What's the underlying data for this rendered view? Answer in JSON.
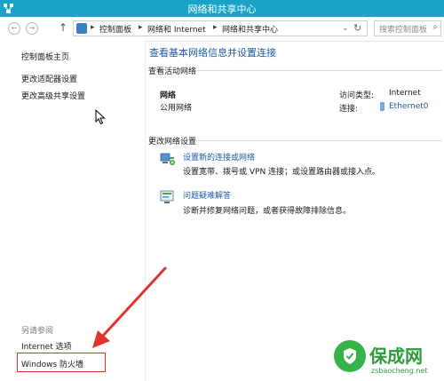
{
  "window": {
    "title": "网络和共享中心"
  },
  "address_bar": {
    "breadcrumbs": [
      "控制面板",
      "网络和 Internet",
      "网络和共享中心"
    ],
    "search_placeholder": "搜索控制面板",
    "dropdown_glyph": "⌄",
    "refresh_glyph": "↻",
    "search_glyph": "⌕",
    "up_glyph": "↑",
    "separator_glyph": "▸",
    "back_glyph": "←",
    "forward_glyph": "→"
  },
  "sidebar": {
    "links": [
      "控制面板主页",
      "更改适配器设置",
      "更改高级共享设置"
    ],
    "see_also_label": "另请参阅",
    "see_also_links": [
      "Internet 选项",
      "Windows 防火墙"
    ]
  },
  "main": {
    "title": "查看基本网络信息并设置连接",
    "active_networks_label": "查看活动网络",
    "network": {
      "name": "网络",
      "type": "公用网络",
      "access_type_label": "访问类型:",
      "access_type_value": "Internet",
      "connections_label": "连接:",
      "connection_value": "Ethernet0"
    },
    "change_settings_label": "更改网络设置",
    "tasks": [
      {
        "title": "设置新的连接或网络",
        "description": "设置宽带、拨号或 VPN 连接；或设置路由器或接入点。"
      },
      {
        "title": "问题疑难解答",
        "description": "诊断并修复网络问题，或者获得故障排除信息。"
      }
    ]
  },
  "watermark": {
    "title": "保成网",
    "url": "zsbaocheng.net"
  },
  "colors": {
    "titlebar": "#19a3c7",
    "link_blue": "#1e5aa8",
    "annotation_red": "#e0332b",
    "watermark_green": "#2a9d3a"
  },
  "icons": [
    "network-app-icon",
    "back-icon",
    "forward-icon",
    "up-arrow-icon",
    "folder-icon",
    "refresh-icon",
    "search-icon",
    "cursor-icon",
    "network-connection-icon",
    "troubleshoot-icon",
    "ethernet-icon"
  ]
}
